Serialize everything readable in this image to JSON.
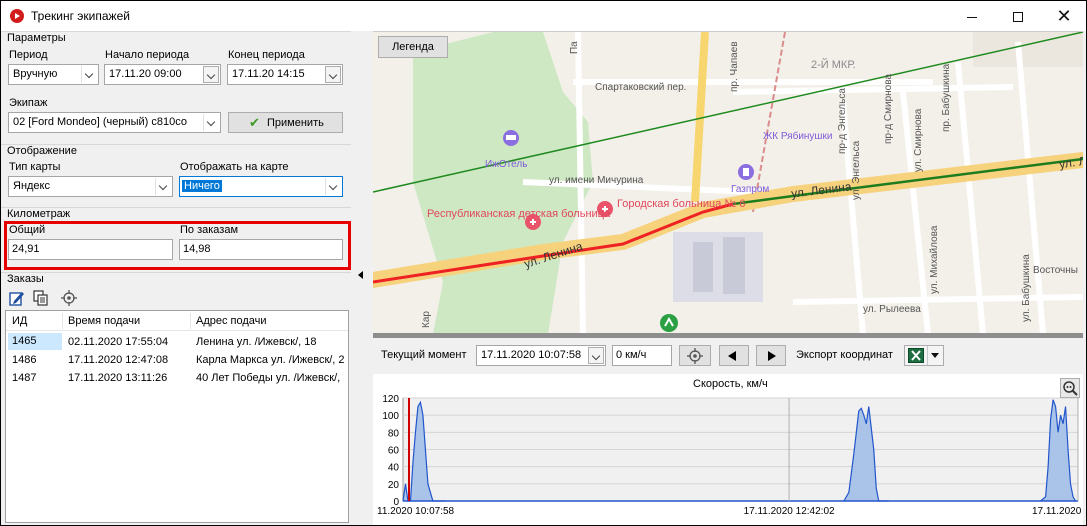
{
  "window": {
    "title": "Трекинг экипажей"
  },
  "params": {
    "group_title": "Параметры",
    "period_label": "Период",
    "period_value": "Вручную",
    "start_label": "Начало периода",
    "start_value": "17.11.20 09:00",
    "end_label": "Конец периода",
    "end_value": "17.11.20 14:15",
    "crew_label": "Экипаж",
    "crew_value": "02 [Ford Mondeo] (черный) с810со",
    "apply_label": "Применить"
  },
  "display": {
    "group_title": "Отображение",
    "map_type_label": "Тип карты",
    "map_type_value": "Яндекс",
    "show_label": "Отображать на карте",
    "show_value": "Ничего"
  },
  "mileage": {
    "group_title": "Километраж",
    "total_label": "Общий",
    "total_value": "24,91",
    "orders_label": "По заказам",
    "orders_value": "14,98"
  },
  "orders": {
    "group_title": "Заказы",
    "columns": [
      "ИД",
      "Время подачи",
      "Адрес подачи"
    ],
    "rows": [
      {
        "id": "1465",
        "time": "02.11.2020 17:55:04",
        "address": "Ленина ул. /Ижевск/, 18"
      },
      {
        "id": "1486",
        "time": "17.11.2020 12:47:08",
        "address": "Карла Маркса ул. /Ижевск/, 2"
      },
      {
        "id": "1487",
        "time": "17.11.2020 13:11:26",
        "address": "40 Лет Победы ул. /Ижевск/,"
      }
    ]
  },
  "map": {
    "legend_label": "Легенда",
    "labels": {
      "spartak": "Спартаковский пер.",
      "mkr": "2-Й МКР.",
      "zhk": "ЖК Рябинушки",
      "hotel": "ИжОтель",
      "michurina": "ул. имени Мичурина",
      "gazprom": "Газпром",
      "lenina1": "ул. Ленина",
      "lenina2": "ул. Ленина",
      "lenina3": "ул. Ле",
      "rep_hosp": "Республиканская детская больница",
      "city_hosp": "Городская больница № 6",
      "ryleeva": "ул. Рылеева",
      "vostoch": "Восточны",
      "chapaev": "пр. Чапаев",
      "engelsa_pr": "пр-д Энгельса",
      "smirnova_pr": "пр-д Смирнова",
      "babushkina_pr": "пр. Бабушкина",
      "smirnova": "ул. Смирнова",
      "engelsa": "ул. Энгельса",
      "mikhailova": "ул. Михайлова",
      "babushkina": "ул. Бабушкина",
      "pa": "Па",
      "kar": "Кар"
    }
  },
  "map_toolbar": {
    "moment_label": "Текущий момент",
    "moment_value": "17.11.2020 10:07:58",
    "speed_value": "0 км/ч",
    "export_label": "Экспорт координат"
  },
  "chart_data": {
    "type": "area",
    "title": "Скорость, км/ч",
    "ylim": [
      0,
      120
    ],
    "yticks": [
      0,
      20,
      40,
      60,
      80,
      100,
      120
    ],
    "xlim_min": [
      607,
      878
    ],
    "x_minutes": [
      607,
      608,
      609,
      610,
      611,
      612,
      613,
      614,
      615,
      616,
      617,
      618,
      619,
      620,
      624,
      784,
      786,
      788,
      790,
      791,
      792,
      793,
      794,
      795,
      796,
      797,
      798,
      800,
      802,
      863,
      865,
      866,
      867,
      868,
      869,
      870,
      871,
      872,
      873,
      874,
      875,
      876,
      877
    ],
    "y_speed": [
      0,
      20,
      0,
      0,
      45,
      80,
      110,
      115,
      100,
      60,
      20,
      10,
      0,
      0,
      0,
      0,
      10,
      55,
      105,
      108,
      100,
      90,
      110,
      85,
      60,
      15,
      0,
      0,
      0,
      0,
      5,
      40,
      95,
      118,
      110,
      80,
      100,
      90,
      110,
      60,
      20,
      5,
      0
    ],
    "x_tick_labels": [
      {
        "minute": 607,
        "label": "11.2020 10:07:58"
      },
      {
        "minute": 762,
        "label": "17.11.2020 12:42:02"
      },
      {
        "minute": 878,
        "label": "17.11.2020"
      }
    ],
    "marker_minute": 607,
    "grid": true
  }
}
